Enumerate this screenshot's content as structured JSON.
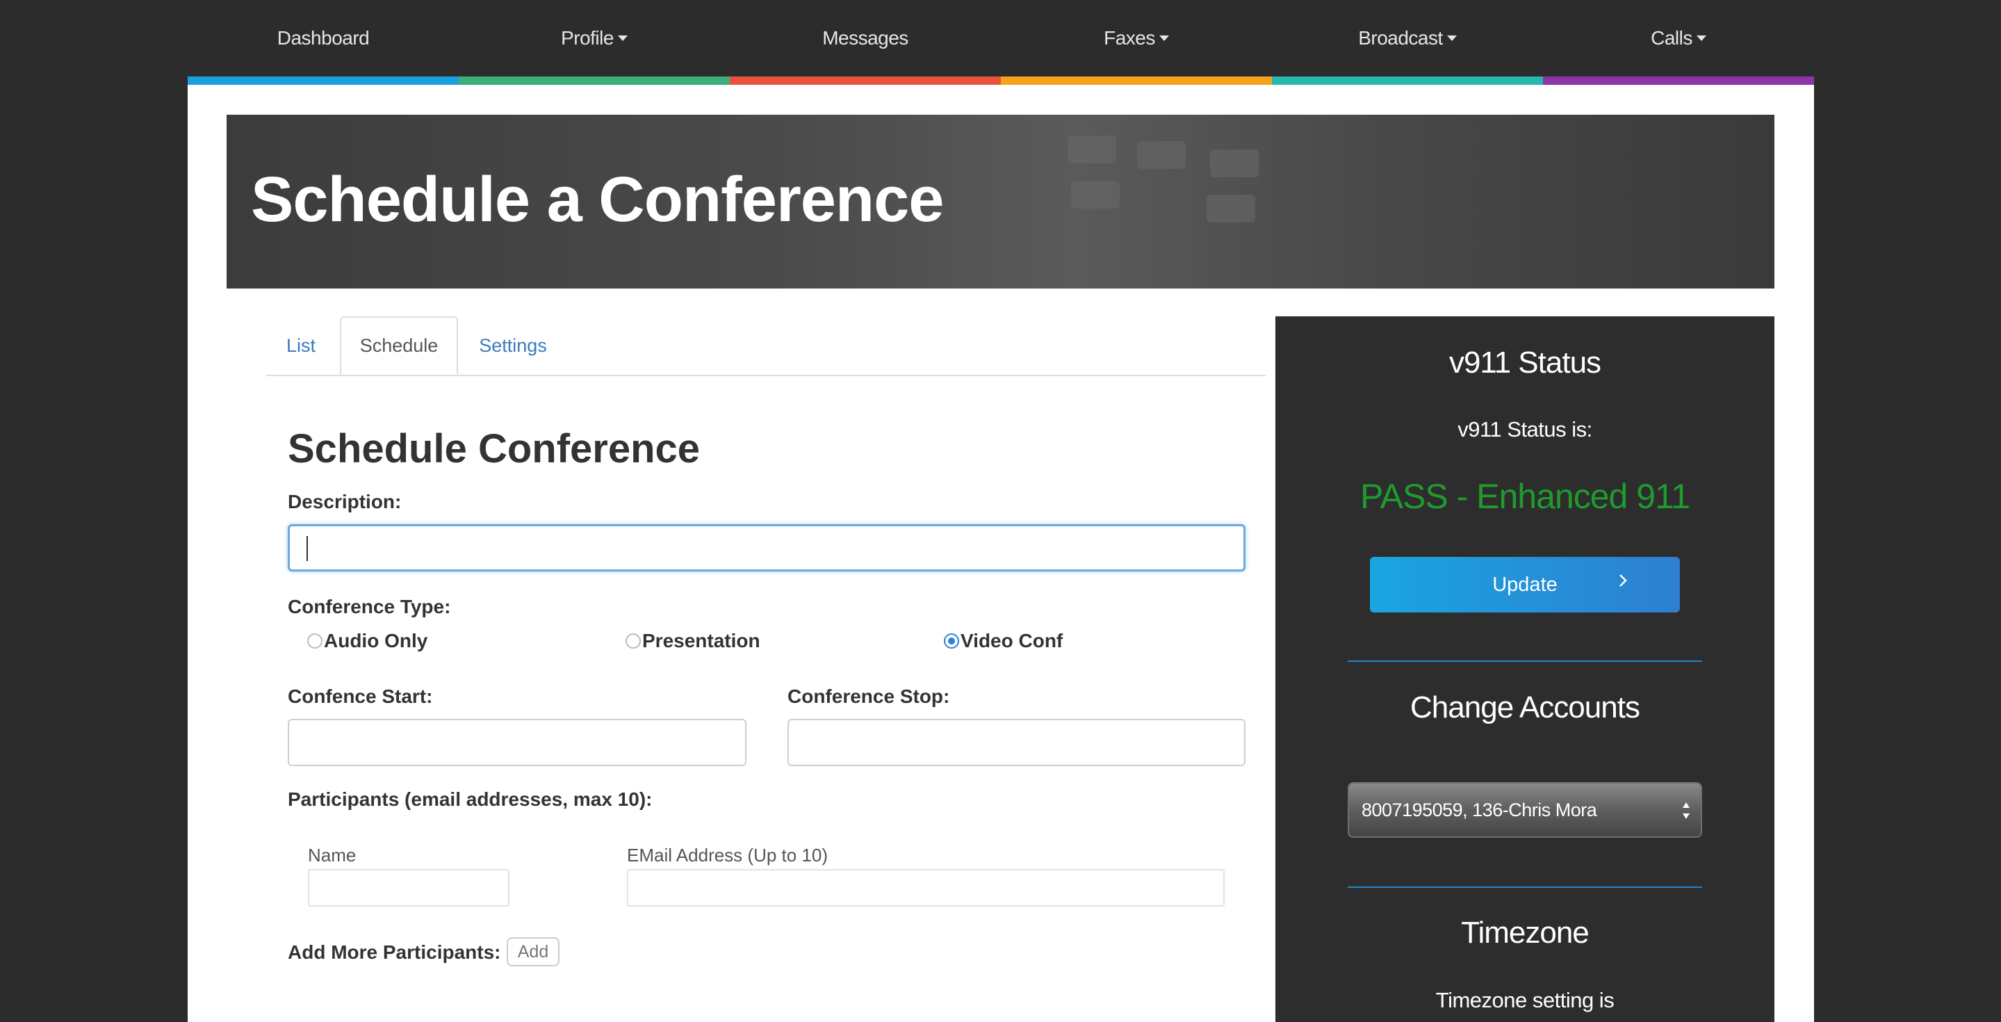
{
  "nav": {
    "items": [
      {
        "label": "Dashboard",
        "caret": false
      },
      {
        "label": "Profile",
        "caret": true
      },
      {
        "label": "Messages",
        "caret": false
      },
      {
        "label": "Faxes",
        "caret": true
      },
      {
        "label": "Broadcast",
        "caret": true
      },
      {
        "label": "Calls",
        "caret": true
      }
    ],
    "bar_colors": [
      "#1a9fe0",
      "#3dae7a",
      "#e9533d",
      "#f7a21b",
      "#27b9b0",
      "#8b35a8"
    ]
  },
  "hero": {
    "title": "Schedule a Conference"
  },
  "tabs": [
    {
      "label": "List",
      "active": false
    },
    {
      "label": "Schedule",
      "active": true
    },
    {
      "label": "Settings",
      "active": false
    }
  ],
  "form": {
    "title": "Schedule Conference",
    "description_label": "Description:",
    "description_value": "",
    "type_label": "Conference Type:",
    "types": [
      {
        "label": "Audio Only",
        "checked": false
      },
      {
        "label": "Presentation",
        "checked": false
      },
      {
        "label": "Video Conf",
        "checked": true
      }
    ],
    "start_label": "Confence Start:",
    "stop_label": "Conference Stop:",
    "participants_label": "Participants (email addresses, max 10):",
    "name_label": "Name",
    "email_label": "EMail Address (Up to 10)",
    "add_more_label": "Add More Participants:",
    "add_button": "Add"
  },
  "sidebar": {
    "v911_title": "v911 Status",
    "v911_status_label": "v911 Status is:",
    "v911_status_value": "PASS - Enhanced 911",
    "status_color": "#1f9b2e",
    "update_button": "Update",
    "change_accounts_title": "Change Accounts",
    "account_selected": "8007195059, 136-Chris Mora",
    "timezone_title": "Timezone",
    "timezone_text": "Timezone setting is"
  }
}
